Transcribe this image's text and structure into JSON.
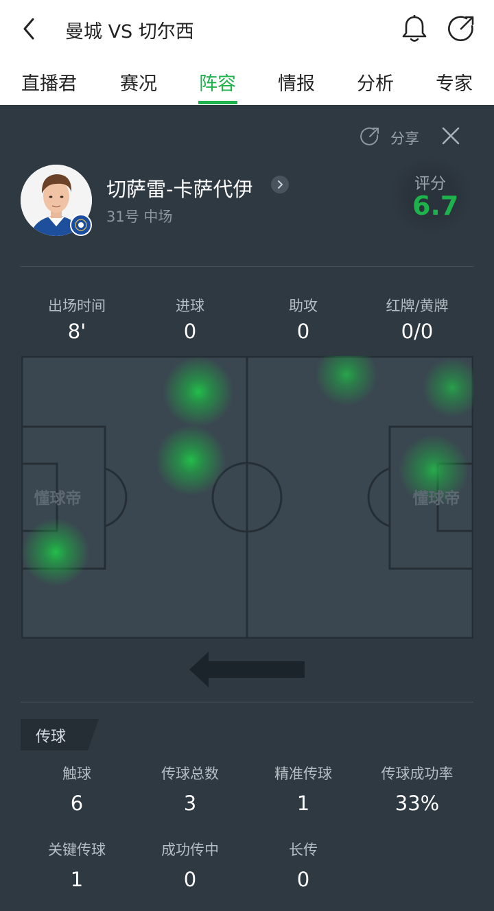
{
  "header": {
    "title": "曼城 VS 切尔西",
    "icons": [
      "back-icon",
      "bell-icon",
      "share-icon"
    ]
  },
  "tabs": [
    {
      "label": "直播君",
      "active": false
    },
    {
      "label": "赛况",
      "active": false
    },
    {
      "label": "阵容",
      "active": true
    },
    {
      "label": "情报",
      "active": false
    },
    {
      "label": "分析",
      "active": false
    },
    {
      "label": "专家",
      "active": false
    }
  ],
  "panel": {
    "share_label": "分享"
  },
  "player": {
    "name": "切萨雷-卡萨代伊",
    "meta": "31号 中场",
    "rating_label": "评分",
    "rating": "6.7"
  },
  "summary": [
    {
      "label": "出场时间",
      "value": "8'"
    },
    {
      "label": "进球",
      "value": "0"
    },
    {
      "label": "助攻",
      "value": "0"
    },
    {
      "label": "红牌/黄牌",
      "value": "0/0"
    }
  ],
  "pitch": {
    "watermark": "懂球帝"
  },
  "passing": {
    "section_label": "传球",
    "row1": [
      {
        "label": "触球",
        "value": "6"
      },
      {
        "label": "传球总数",
        "value": "3"
      },
      {
        "label": "精准传球",
        "value": "1"
      },
      {
        "label": "传球成功率",
        "value": "33%"
      }
    ],
    "row2": [
      {
        "label": "关键传球",
        "value": "1"
      },
      {
        "label": "成功传中",
        "value": "0"
      },
      {
        "label": "长传",
        "value": "0"
      }
    ]
  },
  "colors": {
    "accent": "#1db24c",
    "panel_bg": "#2f3942",
    "pitch_bg": "#3a4650"
  }
}
